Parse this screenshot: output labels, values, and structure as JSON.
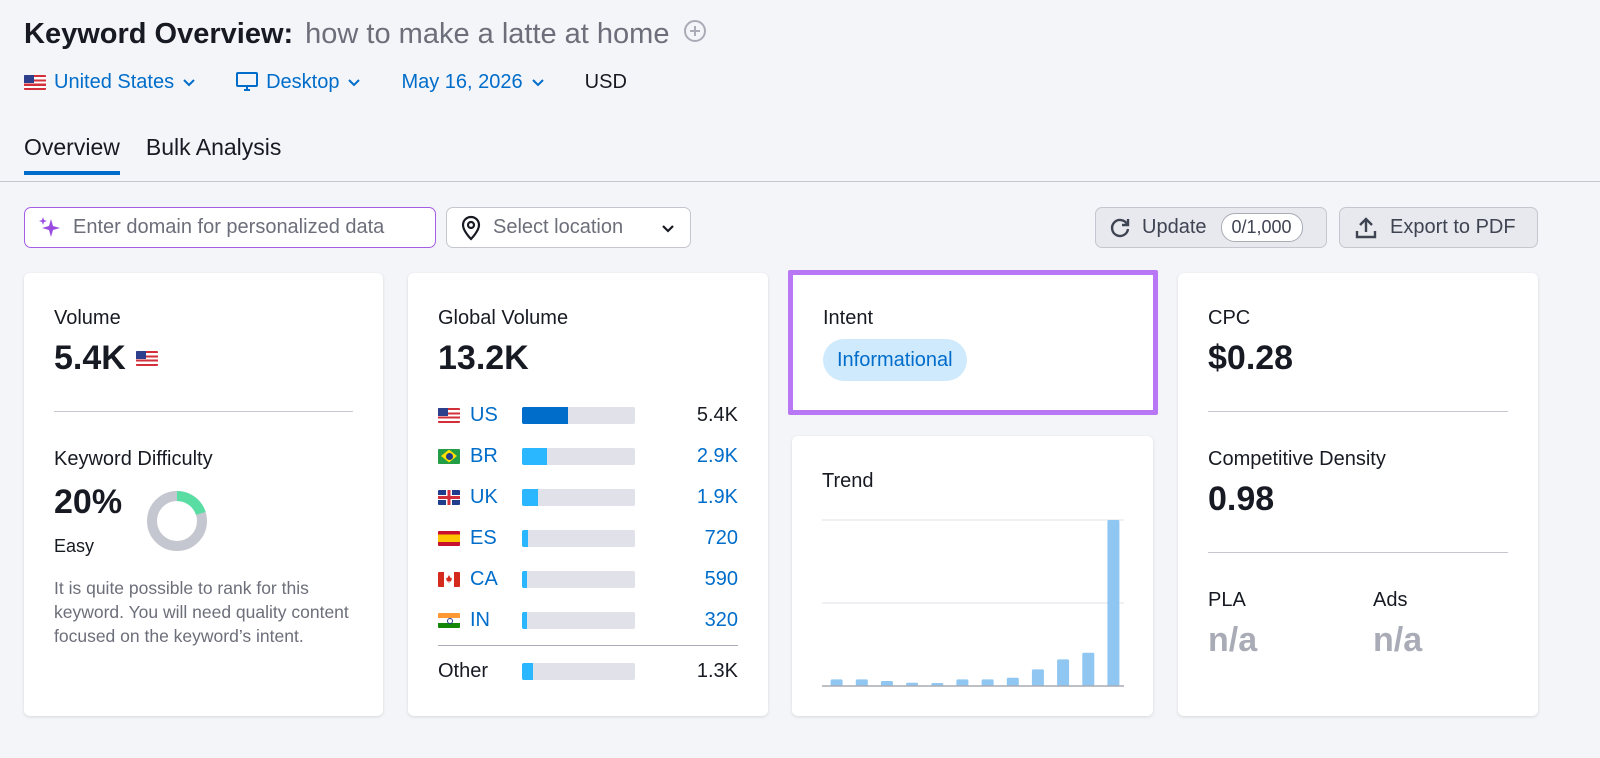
{
  "header": {
    "title": "Keyword Overview:",
    "keyword": "how to make a latte at home",
    "country": "United States",
    "device": "Desktop",
    "date": "May 16, 2026",
    "currency": "USD"
  },
  "tabs": [
    {
      "label": "Overview",
      "active": true
    },
    {
      "label": "Bulk Analysis",
      "active": false
    }
  ],
  "controls": {
    "domain_placeholder": "Enter domain for personalized data",
    "location_placeholder": "Select location",
    "update_label": "Update",
    "update_counter": "0/1,000",
    "export_label": "Export to PDF"
  },
  "volume": {
    "label": "Volume",
    "value": "5.4K",
    "kd_label": "Keyword Difficulty",
    "kd_value": "20%",
    "kd_level": "Easy",
    "kd_percent": 20,
    "kd_description": "It is quite possible to rank for this keyword. You will need quality content focused on the keyword’s intent."
  },
  "global_volume": {
    "label": "Global Volume",
    "value": "13.2K",
    "rows": [
      {
        "code": "US",
        "value": "5.4K",
        "share": 0.41,
        "color": "#006dca"
      },
      {
        "code": "BR",
        "value": "2.9K",
        "share": 0.22,
        "color": "#2bb7ff"
      },
      {
        "code": "UK",
        "value": "1.9K",
        "share": 0.14,
        "color": "#2bb7ff"
      },
      {
        "code": "ES",
        "value": "720",
        "share": 0.055,
        "color": "#2bb7ff"
      },
      {
        "code": "CA",
        "value": "590",
        "share": 0.045,
        "color": "#2bb7ff"
      },
      {
        "code": "IN",
        "value": "320",
        "share": 0.025,
        "color": "#2bb7ff"
      }
    ],
    "other": {
      "label": "Other",
      "value": "1.3K",
      "share": 0.1,
      "color": "#2bb7ff"
    }
  },
  "intent": {
    "label": "Intent",
    "value": "Informational"
  },
  "trend": {
    "label": "Trend",
    "values": [
      4,
      4,
      3,
      2,
      1,
      4,
      4,
      5,
      10,
      16,
      20,
      100
    ]
  },
  "cpc": {
    "label": "CPC",
    "value": "$0.28",
    "cd_label": "Competitive Density",
    "cd_value": "0.98",
    "pla_label": "PLA",
    "pla_value": "n/a",
    "ads_label": "Ads",
    "ads_value": "n/a"
  },
  "colors": {
    "accent": "#006dca",
    "intent_border": "#b877f5",
    "kd_easy": "#59dda2",
    "kd_track": "#c4c7cf",
    "trend_bar": "#8fc6f2"
  }
}
